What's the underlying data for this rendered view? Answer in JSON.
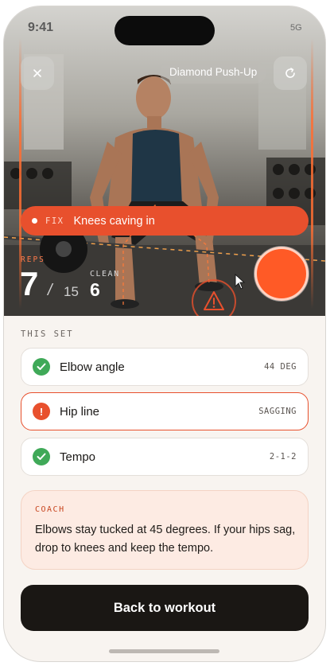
{
  "status": {
    "time": "9:41",
    "signal": "5G"
  },
  "header": {
    "title": "Diamond Push-Up"
  },
  "fix": {
    "tag": "FIX",
    "message": "Knees caving in"
  },
  "reps": {
    "label": "REPS",
    "count": "7",
    "slash": "/",
    "total": "15"
  },
  "clean": {
    "label": "CLEAN",
    "count": "6"
  },
  "set": {
    "label": "THIS SET",
    "checks": [
      {
        "label": "Elbow angle",
        "value": "44 DEG",
        "state": "ok"
      },
      {
        "label": "Hip line",
        "value": "SAGGING",
        "state": "alert"
      },
      {
        "label": "Tempo",
        "value": "2-1-2",
        "state": "ok"
      }
    ]
  },
  "coach": {
    "label": "COACH",
    "text": "Elbows stay tucked at 45 degrees. If your hips sag, drop to knees and keep the tempo."
  },
  "actions": {
    "back_label": "Back to workout"
  },
  "icons": {
    "close": "close-icon",
    "refresh": "refresh-icon",
    "check": "check-icon",
    "alert": "alert-icon",
    "warning": "warning-icon"
  },
  "colors": {
    "accent": "#e8502d",
    "record": "#ff5a26",
    "ok": "#3fa958",
    "dark": "#1a1714"
  }
}
